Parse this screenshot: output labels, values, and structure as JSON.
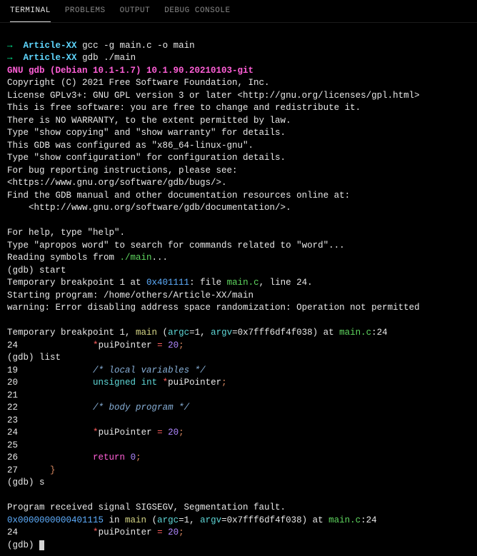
{
  "tabs": {
    "terminal": "TERMINAL",
    "problems": "PROBLEMS",
    "output": "OUTPUT",
    "debug": "DEBUG CONSOLE"
  },
  "prompt": {
    "arrow": "→",
    "dir": "Article-XX",
    "cmd1": "gcc -g main.c -o main",
    "cmd2": "gdb ./main"
  },
  "gdb": {
    "version": "GNU gdb (Debian 10.1-1.7) 10.1.90.20210103-git",
    "copyright": "Copyright (C) 2021 Free Software Foundation, Inc.",
    "license": "License GPLv3+: GNU GPL version 3 or later <http://gnu.org/licenses/gpl.html>",
    "free": "This is free software: you are free to change and redistribute it.",
    "warranty": "There is NO WARRANTY, to the extent permitted by law.",
    "showcopy": "Type \"show copying\" and \"show warranty\" for details.",
    "configured": "This GDB was configured as \"x86_64-linux-gnu\".",
    "showconfig": "Type \"show configuration\" for configuration details.",
    "bugreport": "For bug reporting instructions, please see:",
    "bugurl": "<https://www.gnu.org/software/gdb/bugs/>.",
    "findmanual": "Find the GDB manual and other documentation resources online at:",
    "docurl": "    <http://www.gnu.org/software/gdb/documentation/>.",
    "blank": "",
    "forhelp": "For help, type \"help\".",
    "apropos": "Type \"apropos word\" to search for commands related to \"word\"...",
    "reading": "Reading symbols from ",
    "mainfile": "./main",
    "dots": "...",
    "gdbprompt": "(gdb) ",
    "startcmd": "start",
    "tempbp": "Temporary breakpoint 1 at ",
    "addr1": "0x401111",
    "filecolon": ": file ",
    "mainc": "main.c",
    "line24": ", line 24.",
    "starting": "Starting program: /home/others/Article-XX/main",
    "warning": "warning: Error disabling address space randomization: Operation not permitted",
    "tempbp2": "Temporary breakpoint 1, ",
    "main": "main",
    "paren": " (",
    "argc": "argc",
    "eq1": "=1, ",
    "argv": "argv",
    "argvval": "=0x7fff6df4f038) at ",
    "colon24": ":24",
    "line24num": "24",
    "spaces1": "              ",
    "star": "*",
    "puipointer": "puiPointer ",
    "equals": "= ",
    "twenty": "20",
    "semi": ";",
    "listcmd": "list",
    "line19": "19",
    "comment1": "/* local variables */",
    "line20": "20",
    "unsigned": "unsigned",
    "int": "int",
    "puipointer2": "puiPointer",
    "line21": "21",
    "line22": "22",
    "comment2": "/* body program */",
    "line23": "23",
    "line25": "25",
    "line26": "26",
    "return": "return",
    "zero": "0",
    "line27": "27",
    "brace": "}",
    "scmd": "s",
    "sigsegv": "Program received signal SIGSEGV, Segmentation fault.",
    "addr2": "0x0000000000401115",
    "in": " in "
  }
}
